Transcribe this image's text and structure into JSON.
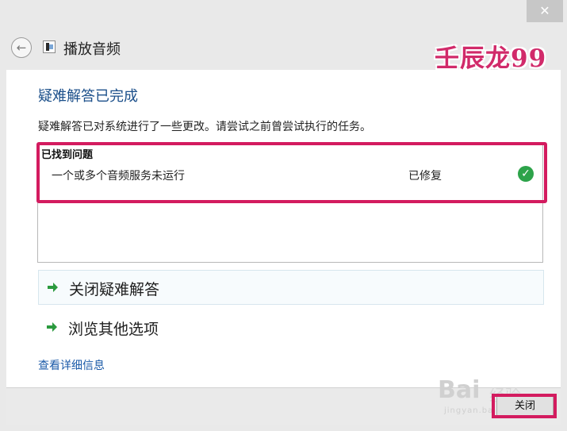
{
  "window": {
    "close_glyph": "✕"
  },
  "header": {
    "back_glyph": "←",
    "title": "播放音频",
    "icon": "audio-troubleshooter-icon"
  },
  "watermark": {
    "text": "壬辰龙99",
    "color": "#d12a6a",
    "baidu_logo": "Bai",
    "baidu_jingyan": "经验",
    "url": "jingyan.baidu.com"
  },
  "main": {
    "heading": "疑难解答已完成",
    "description": "疑难解答已对系统进行了一些更改。请尝试之前曾尝试执行的任务。",
    "issues_title": "已找到问题",
    "issues": [
      {
        "name": "一个或多个音频服务未运行",
        "status": "已修复",
        "status_icon": "check-icon"
      }
    ],
    "actions": [
      {
        "label": "关闭疑难解答",
        "icon": "green-arrow-icon"
      },
      {
        "label": "浏览其他选项",
        "icon": "green-arrow-icon"
      }
    ],
    "details_link": "查看详细信息"
  },
  "footer": {
    "close_label": "关闭"
  },
  "colors": {
    "accent": "#1b4f8a",
    "highlight": "#d31b5f",
    "success": "#2da34a",
    "link": "#1b5aa8"
  }
}
